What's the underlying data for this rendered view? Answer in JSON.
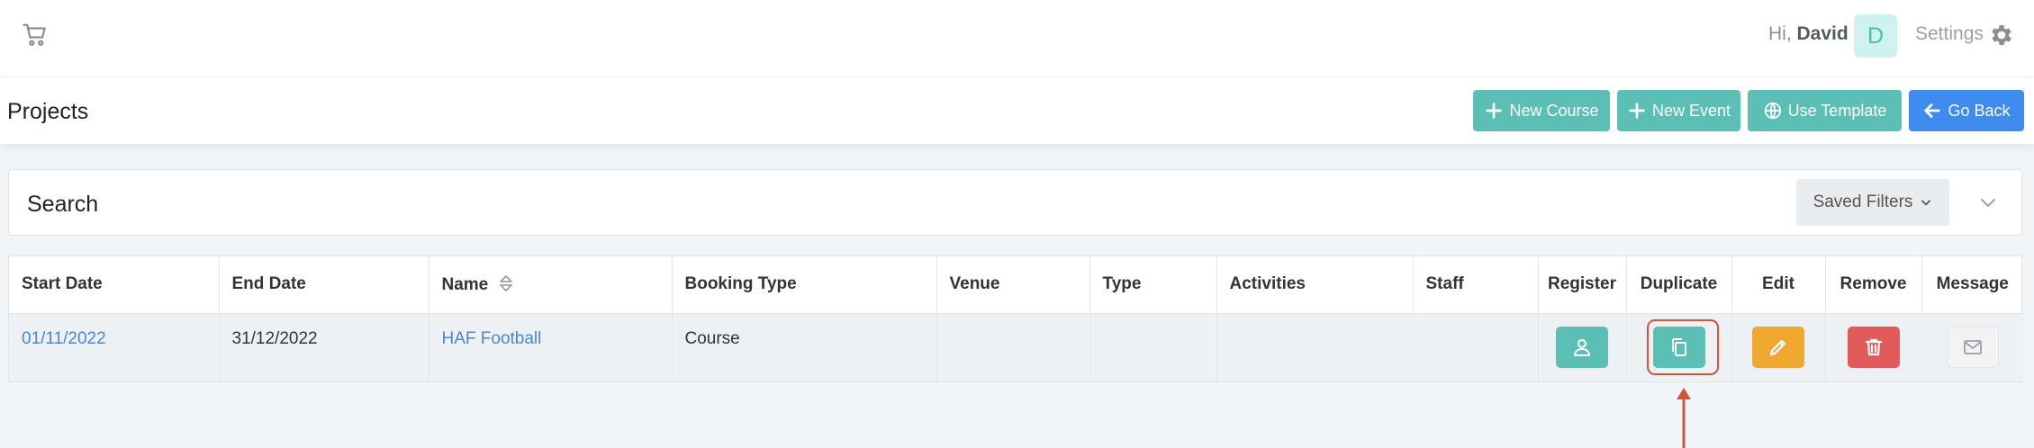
{
  "topbar": {
    "greeting_prefix": "Hi,",
    "user_name": "David",
    "avatar_initial": "D",
    "settings_label": "Settings"
  },
  "header": {
    "title": "Projects",
    "buttons": {
      "new_course": "New Course",
      "new_event": "New Event",
      "use_template": "Use Template",
      "go_back": "Go Back"
    }
  },
  "search": {
    "label": "Search",
    "saved_filters": "Saved Filters"
  },
  "table": {
    "columns": [
      "Start Date",
      "End Date",
      "Name",
      "Booking Type",
      "Venue",
      "Type",
      "Activities",
      "Staff",
      "Register",
      "Duplicate",
      "Edit",
      "Remove",
      "Message"
    ],
    "rows": [
      {
        "start_date": "01/11/2022",
        "end_date": "31/12/2022",
        "name": "HAF Football",
        "booking_type": "Course",
        "venue": "",
        "type": "",
        "activities": "",
        "staff": ""
      }
    ]
  },
  "colors": {
    "teal": "#5cbfb6",
    "blue": "#3f8bf0",
    "orange": "#f0a830",
    "red": "#e25b5b",
    "highlight": "#d4533f"
  },
  "icons": [
    "cart-icon",
    "gear-icon",
    "plus-icon",
    "globe-icon",
    "arrow-left-icon",
    "sort-icon",
    "chevron-down-icon",
    "user-icon",
    "copy-icon",
    "pencil-icon",
    "trash-icon",
    "envelope-icon",
    "arrow-up-icon"
  ]
}
